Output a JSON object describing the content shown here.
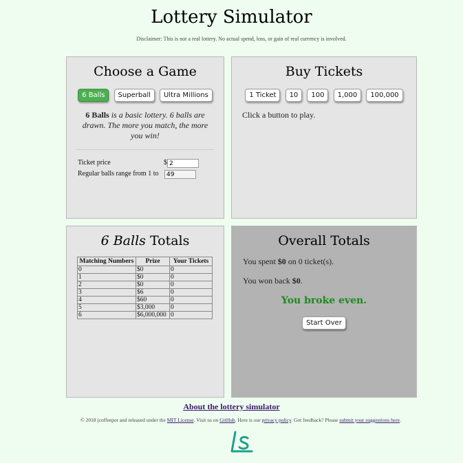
{
  "page": {
    "title": "Lottery Simulator",
    "disclaimer": "Disclaimer: This is not a real lottery. No actual spend, loss, or gain of real currency is involved."
  },
  "choose_game": {
    "heading": "Choose a Game",
    "games": [
      {
        "label": "6 Balls",
        "active": true
      },
      {
        "label": "Superball",
        "active": false
      },
      {
        "label": "Ultra Millions",
        "active": false
      }
    ],
    "desc_name": "6 Balls",
    "desc_text": " is a basic lottery. 6 balls are drawn. The more you match, the more you win!",
    "ticket_price_label": "Ticket price",
    "ticket_price_prefix": "$",
    "ticket_price_value": "2",
    "range_label": "Regular balls range from 1 to",
    "range_value": "49"
  },
  "buy_tickets": {
    "heading": "Buy Tickets",
    "buttons": [
      "1 Ticket",
      "10",
      "100",
      "1,000",
      "100,000"
    ],
    "prompt": "Click a button to play."
  },
  "game_totals": {
    "heading_game": "6 Balls",
    "heading_suffix": " Totals",
    "columns": [
      "Matching Numbers",
      "Prize",
      "Your Tickets"
    ],
    "rows": [
      [
        "0",
        "$0",
        "0"
      ],
      [
        "1",
        "$0",
        "0"
      ],
      [
        "2",
        "$0",
        "0"
      ],
      [
        "3",
        "$6",
        "0"
      ],
      [
        "4",
        "$60",
        "0"
      ],
      [
        "5",
        "$3,000",
        "0"
      ],
      [
        "6",
        "$6,000,000",
        "0"
      ]
    ]
  },
  "overall": {
    "heading": "Overall Totals",
    "spent_prefix": "You spent ",
    "spent_amount": "$0",
    "spent_suffix": " on 0 ticket(s).",
    "won_prefix": "You won back ",
    "won_amount": "$0",
    "won_suffix": ".",
    "result": "You broke even.",
    "start_over": "Start Over"
  },
  "footer": {
    "about_link": "About the lottery simulator",
    "copyright": "© 2018 jcoffeepot and released under the ",
    "license_link": "MIT License",
    "visit_text": ". Visit us on ",
    "github_link": "GitHub",
    "privacy_pre": ". Here is our ",
    "privacy_link": "privacy policy",
    "feedback_pre": ". Got feedback? Please ",
    "suggest_link": "submit your suggestions here",
    "end": "."
  },
  "colors": {
    "background": "#eefdf0",
    "panel": "#e5e5e5",
    "panel_dark": "#b3b3b3",
    "active_button": "#4caf50",
    "result_green": "#1a8a1a",
    "logo_teal": "#1ea08a"
  },
  "logo": {
    "icon": "ls-logo-icon"
  }
}
